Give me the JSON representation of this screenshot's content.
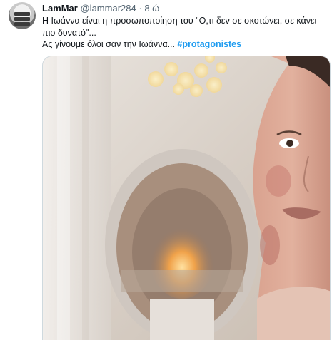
{
  "tweet": {
    "author_name": "LamMar",
    "author_handle": "@lammar284",
    "separator": "·",
    "time": "8 ώ",
    "text_line1": "Η Ιωάννα είναι η προσωποποίηση του \"Ο,τι δεν σε σκοτώνει, σε κάνει πιο δυνατό\"...",
    "text_line2_prefix": "Ας γίνουμε όλοι σαν την Ιωάννα... ",
    "hashtag": "#protagonistes"
  },
  "colors": {
    "link": "#1d9bf0",
    "secondary_text": "#536471",
    "primary_text": "#0f1419"
  },
  "icons": {
    "avatar": "user-avatar"
  }
}
